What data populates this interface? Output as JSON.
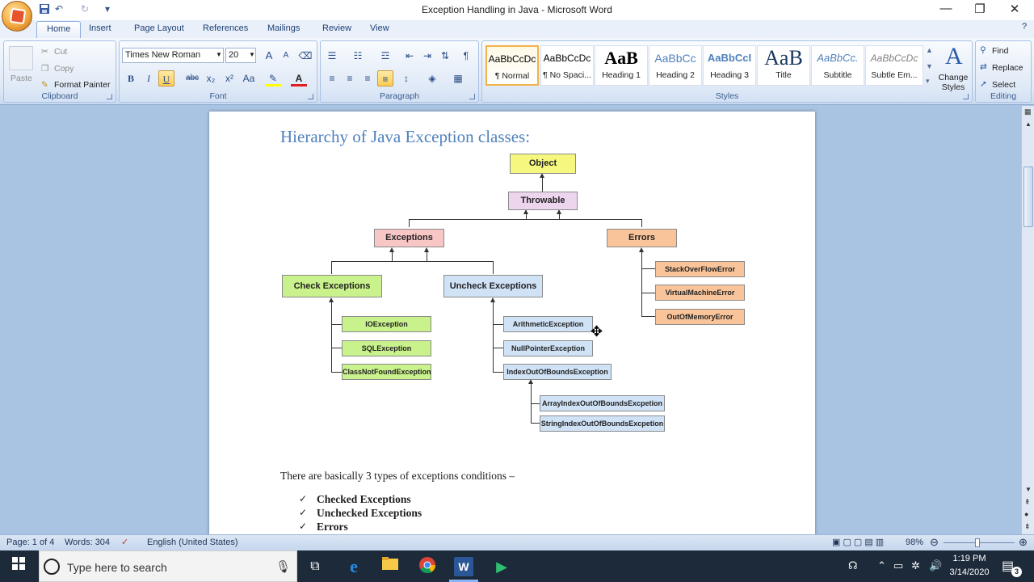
{
  "window": {
    "title": "Exception Handling in Java - Microsoft Word"
  },
  "quick_access": {
    "undo_icon": "↶",
    "redo_icon": "↻",
    "customize_icon": "▾"
  },
  "tabs": [
    "Home",
    "Insert",
    "Page Layout",
    "References",
    "Mailings",
    "Review",
    "View"
  ],
  "clipboard": {
    "paste": "Paste",
    "cut": "Cut",
    "copy": "Copy",
    "format_painter": "Format Painter",
    "label": "Clipboard"
  },
  "font": {
    "name": "Times New Roman",
    "size": "20",
    "label": "Font",
    "bold": "B",
    "italic": "I",
    "underline": "U",
    "strike": "abc",
    "sub": "x₂",
    "sup": "x²",
    "case": "Aa",
    "grow": "A",
    "shrink": "A"
  },
  "paragraph": {
    "label": "Paragraph"
  },
  "styles": {
    "label": "Styles",
    "items": [
      {
        "preview": "AaBbCcDc",
        "name": "¶ Normal"
      },
      {
        "preview": "AaBbCcDc",
        "name": "¶ No Spaci..."
      },
      {
        "preview": "AaB",
        "name": "Heading 1"
      },
      {
        "preview": "AaBbCc",
        "name": "Heading 2"
      },
      {
        "preview": "AaBbCcI",
        "name": "Heading 3"
      },
      {
        "preview": "AaB",
        "name": "Title"
      },
      {
        "preview": "AaBbCc.",
        "name": "Subtitle"
      },
      {
        "preview": "AaBbCcDc",
        "name": "Subtle Em..."
      }
    ],
    "change_styles": "Change Styles"
  },
  "editing": {
    "find": "Find",
    "replace": "Replace",
    "select": "Select",
    "label": "Editing"
  },
  "document": {
    "heading": "Hierarchy of Java Exception classes:",
    "diagram": {
      "object": "Object",
      "throwable": "Throwable",
      "exceptions": "Exceptions",
      "errors": "Errors",
      "check": "Check Exceptions",
      "uncheck": "Uncheck Exceptions",
      "stackoverflow": "StackOverFlowError",
      "vm": "VirtualMachineError",
      "oom": "OutOfMemoryError",
      "io": "IOException",
      "sql": "SQLException",
      "cnf": "ClassNotFoundException",
      "arith": "ArithmeticException",
      "npe": "NullPointerException",
      "ioob": "IndexOutOfBoundsException",
      "aioob": "ArrayIndexOutOfBoundsExcpetion",
      "sioob": "StringIndexOutOfBoundsExcpetion"
    },
    "intro": "There are basically 3 types of exceptions conditions –",
    "list": [
      "Checked Exceptions",
      "Unchecked Exceptions",
      "Errors"
    ],
    "check_glyph": "✓"
  },
  "status": {
    "page": "Page: 1 of 4",
    "words": "Words: 304",
    "language": "English (United States)",
    "zoom": "98%"
  },
  "taskbar": {
    "search_placeholder": "Type here to search",
    "time": "1:19 PM",
    "date": "3/14/2020",
    "notifications": "3"
  }
}
